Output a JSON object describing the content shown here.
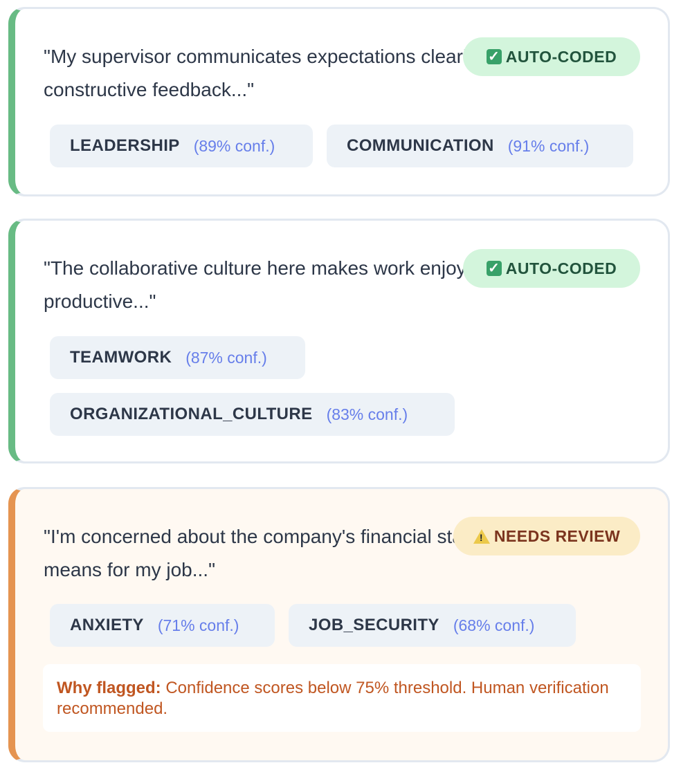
{
  "items": [
    {
      "quote": "\"My supervisor communicates expectations clearly and provides constructive feedback...\"",
      "status": "AUTO-CODED",
      "status_icon": "check-icon",
      "tags": [
        {
          "name": "LEADERSHIP",
          "conf": "(89% conf.)"
        },
        {
          "name": "COMMUNICATION",
          "conf": "(91% conf.)"
        }
      ]
    },
    {
      "quote": "\"The collaborative culture here makes work enjoyable and productive...\"",
      "status": "AUTO-CODED",
      "status_icon": "check-icon",
      "tags": [
        {
          "name": "TEAMWORK",
          "conf": "(87% conf.)"
        },
        {
          "name": "ORGANIZATIONAL_CULTURE",
          "conf": "(83% conf.)"
        }
      ]
    },
    {
      "quote": "\"I'm concerned about the company's financial stability and what it means for my job...\"",
      "status": "NEEDS REVIEW",
      "status_icon": "warning-icon",
      "tags": [
        {
          "name": "ANXIETY",
          "conf": "(71% conf.)"
        },
        {
          "name": "JOB_SECURITY",
          "conf": "(68% conf.)"
        }
      ],
      "flag_label": "Why flagged:",
      "flag_text": " Confidence scores below 75% threshold. Human verification recommended."
    }
  ],
  "colors": {
    "auto_accent": "#68bb84",
    "review_accent": "#e59451",
    "auto_badge_bg": "#d3f5dc",
    "review_badge_bg": "#fbecc6",
    "confidence_text": "#667eea",
    "flag_text": "#c05621"
  }
}
